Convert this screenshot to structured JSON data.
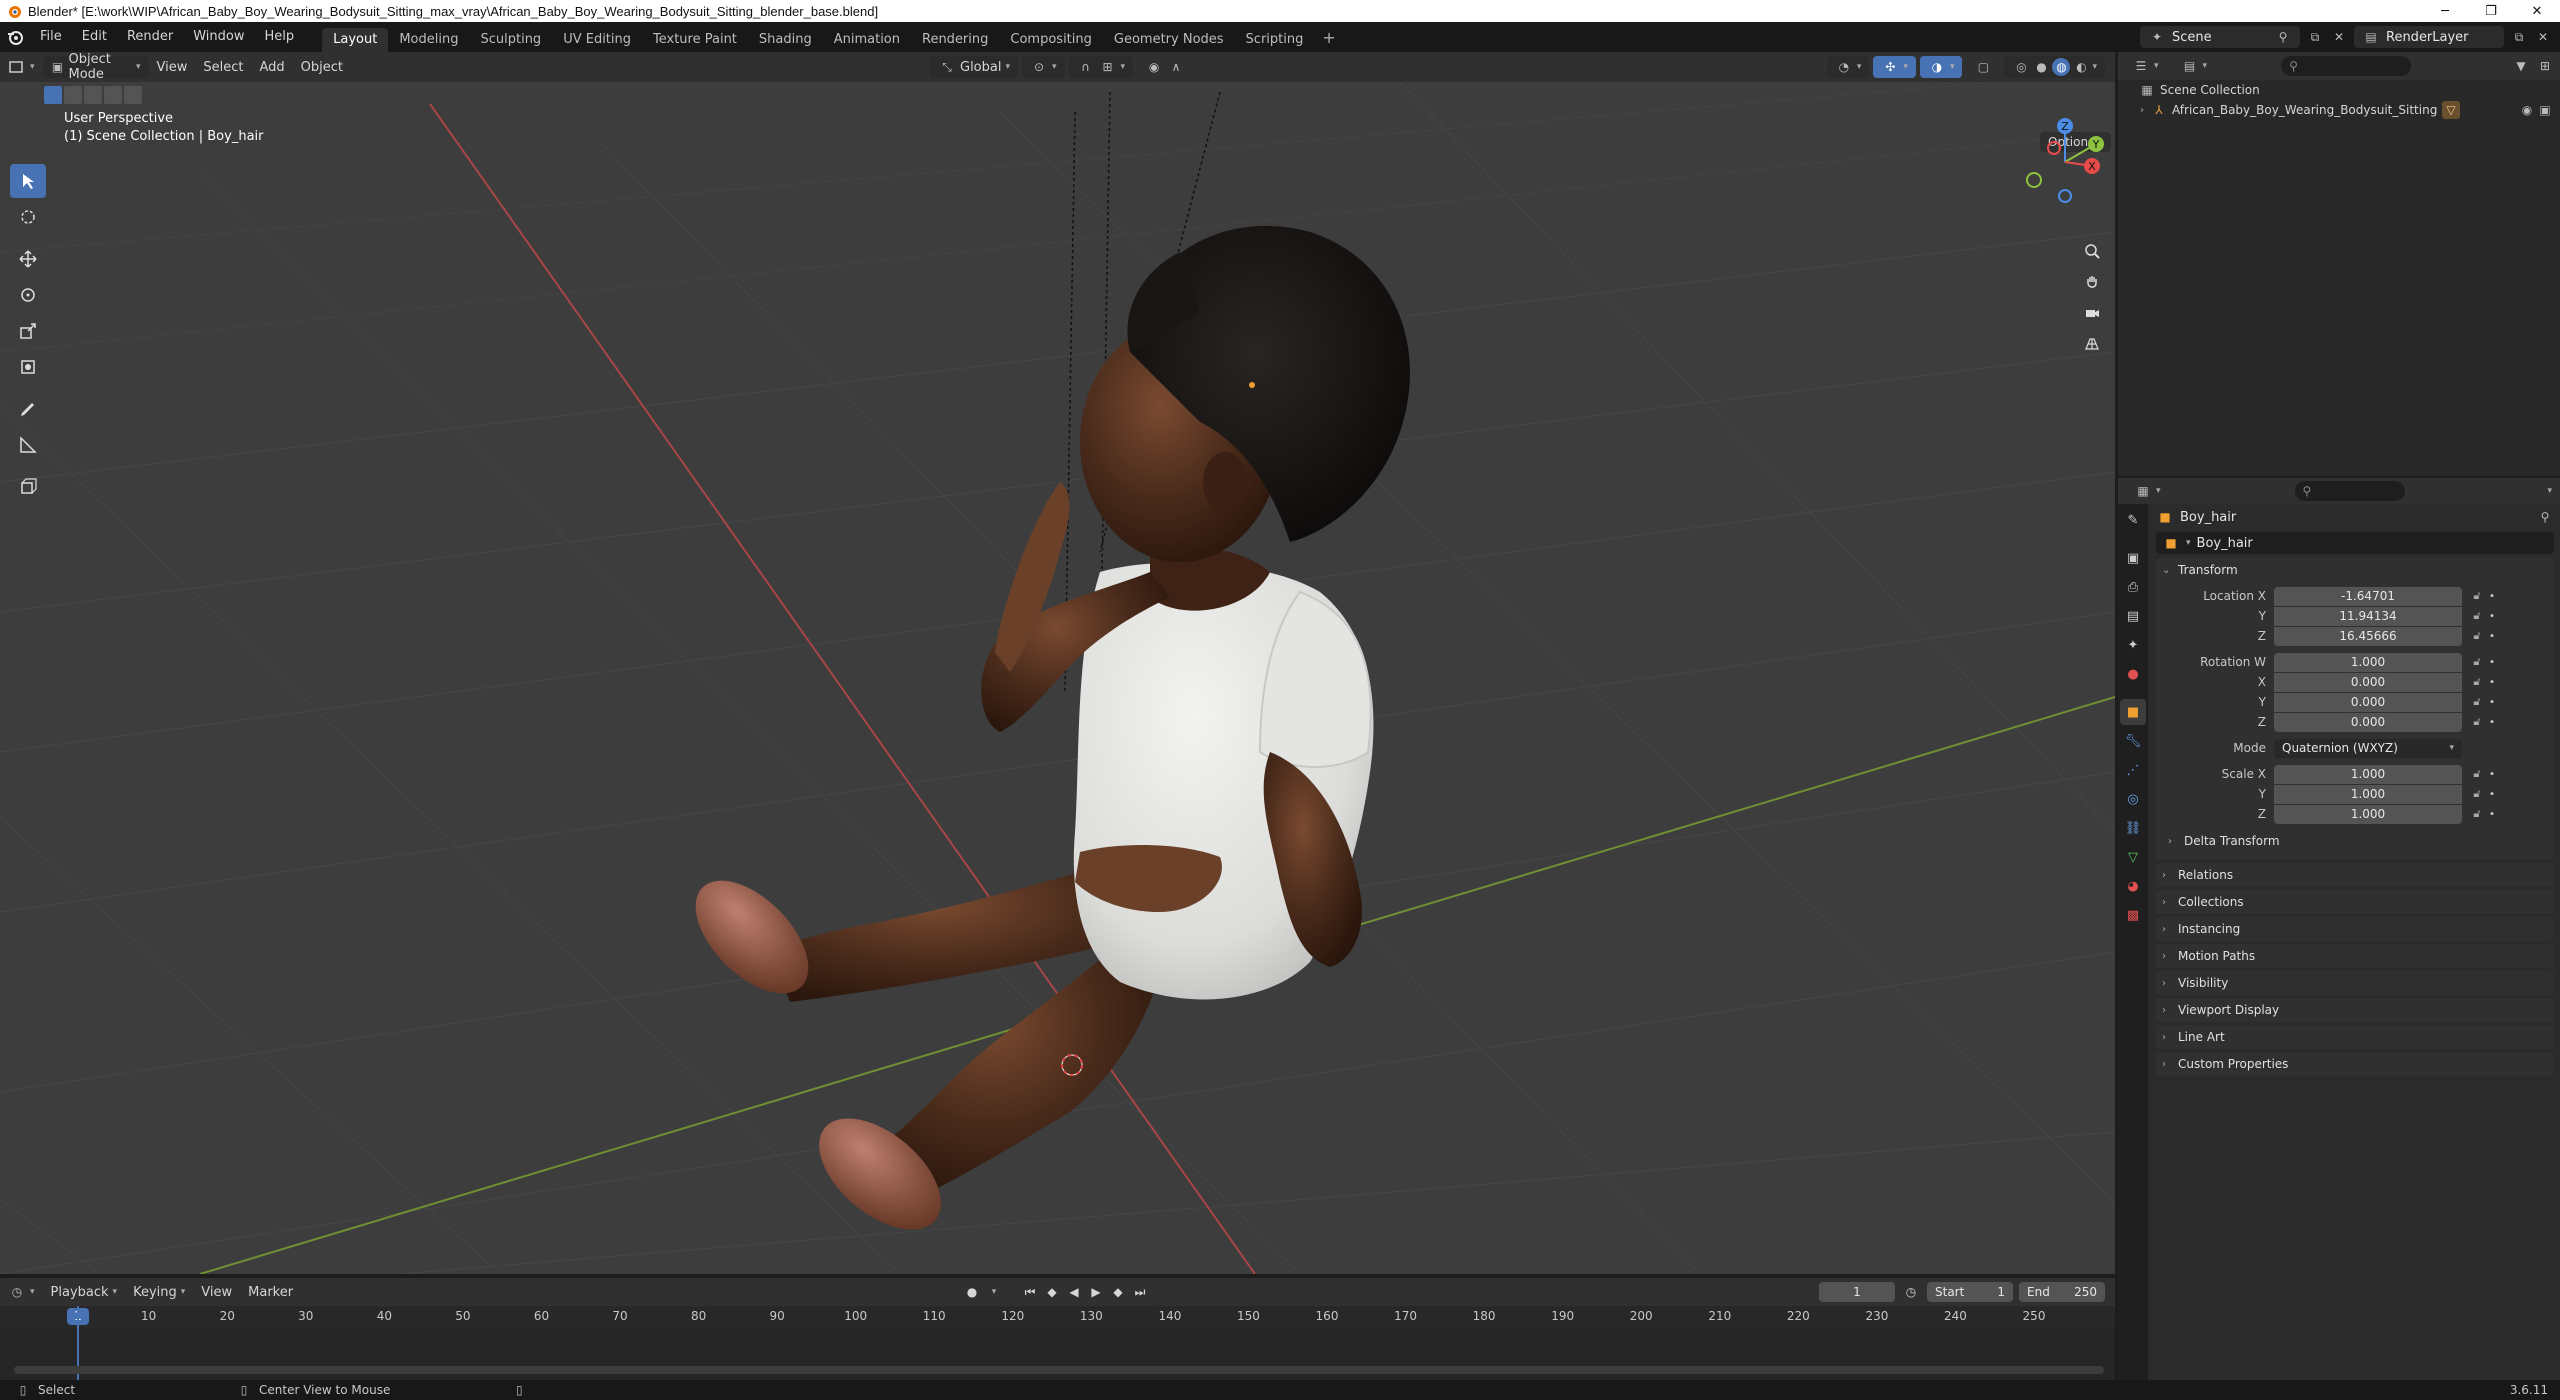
{
  "window": {
    "title": "Blender* [E:\\work\\WIP\\African_Baby_Boy_Wearing_Bodysuit_Sitting_max_vray\\African_Baby_Boy_Wearing_Bodysuit_Sitting_blender_base.blend]",
    "minimize": "─",
    "maximize": "❐",
    "close": "✕"
  },
  "menu": [
    "File",
    "Edit",
    "Render",
    "Window",
    "Help"
  ],
  "workspaces": [
    "Layout",
    "Modeling",
    "Sculpting",
    "UV Editing",
    "Texture Paint",
    "Shading",
    "Animation",
    "Rendering",
    "Compositing",
    "Geometry Nodes",
    "Scripting"
  ],
  "active_workspace": "Layout",
  "workspace_add": "+",
  "scene": {
    "name": "Scene",
    "view_layer": "RenderLayer"
  },
  "viewport": {
    "mode": "Object Mode",
    "menus": [
      "View",
      "Select",
      "Add",
      "Object"
    ],
    "transform_orientation": "Global",
    "options_label": "Options",
    "info_line1": "User Perspective",
    "info_line2": "(1) Scene Collection | Boy_hair",
    "gizmo": {
      "x": "X",
      "y": "Y",
      "z": "Z"
    }
  },
  "timeline": {
    "menus": [
      "Playback",
      "Keying",
      "View",
      "Marker"
    ],
    "current_frame": "1",
    "start_label": "Start",
    "start": "1",
    "end_label": "End",
    "end": "250",
    "ticks": [
      "1",
      "10",
      "20",
      "30",
      "40",
      "50",
      "60",
      "70",
      "80",
      "90",
      "100",
      "110",
      "120",
      "130",
      "140",
      "150",
      "160",
      "170",
      "180",
      "190",
      "200",
      "210",
      "220",
      "230",
      "240",
      "250"
    ]
  },
  "statusbar": {
    "select": "Select",
    "center_view": "Center View to Mouse",
    "version": "3.6.11"
  },
  "outliner": {
    "root": "Scene Collection",
    "items": [
      "African_Baby_Boy_Wearing_Bodysuit_Sitting"
    ]
  },
  "properties": {
    "object_name": "Boy_hair",
    "object_field": "Boy_hair",
    "transform": {
      "title": "Transform",
      "location_label": "Location X",
      "location": [
        "-1.64701",
        "11.94134",
        "16.45666"
      ],
      "rotation_label": "Rotation W",
      "rotation": [
        "1.000",
        "0.000",
        "0.000",
        "0.000"
      ],
      "mode_label": "Mode",
      "mode": "Quaternion (WXYZ)",
      "scale_label": "Scale X",
      "scale": [
        "1.000",
        "1.000",
        "1.000"
      ],
      "axis_y": "Y",
      "axis_z": "Z",
      "axis_x": "X",
      "delta": "Delta Transform"
    },
    "panels": [
      "Relations",
      "Collections",
      "Instancing",
      "Motion Paths",
      "Visibility",
      "Viewport Display",
      "Line Art",
      "Custom Properties"
    ]
  },
  "colors": {
    "accent": "#4772b3",
    "x_axis": "#e94b4b",
    "y_axis": "#8dc23e",
    "z_axis": "#4c8de8",
    "viewport_bg": "#3d3d3d",
    "skin": "#4a2b1b",
    "hair": "#151312",
    "bodysuit": "#e8e8e6"
  }
}
